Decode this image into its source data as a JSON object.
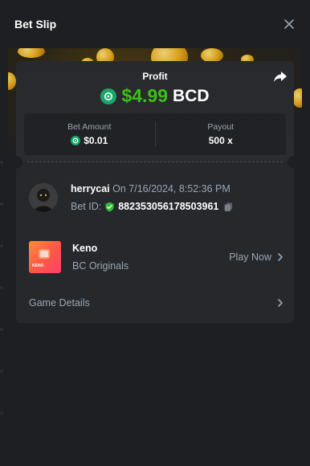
{
  "modal": {
    "title": "Bet Slip",
    "close_icon": "close-icon"
  },
  "profit": {
    "label": "Profit",
    "amount": "$4.99",
    "currency": "BCD",
    "currency_icon": "bc-coin-icon",
    "share_icon": "share-icon"
  },
  "stats": {
    "bet_amount_label": "Bet Amount",
    "bet_amount_value": "$0.01",
    "payout_label": "Payout",
    "payout_value": "500 x"
  },
  "user": {
    "name": "herrycai",
    "datetime": "On 7/16/2024, 8:52:36 PM",
    "bet_id_label": "Bet ID:",
    "bet_id": "882353056178503961"
  },
  "game": {
    "name": "Keno",
    "provider": "BC Originals",
    "play_label": "Play Now",
    "thumb_text": "KENO"
  },
  "details": {
    "label": "Game Details"
  },
  "colors": {
    "accent_green": "#3bc117",
    "bc_green": "#1aa56a",
    "muted_text": "#98a7b5"
  }
}
